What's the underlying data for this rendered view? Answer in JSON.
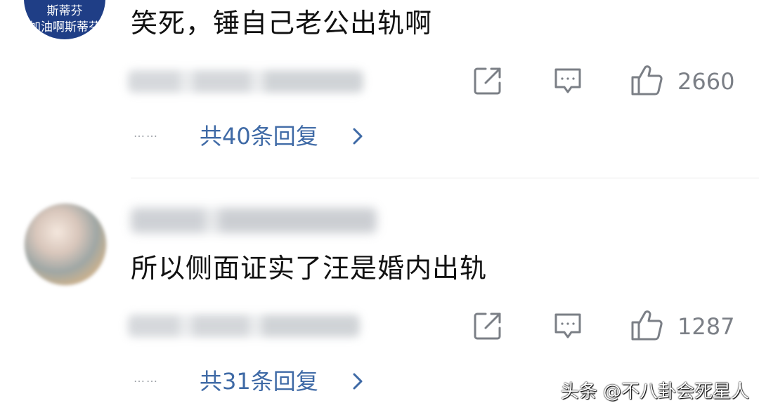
{
  "comments": [
    {
      "avatar_name": "斯蒂芬",
      "avatar_slogan": "加油啊斯蒂芬",
      "text": "笑死，锤自己老公出轨啊",
      "likes": "2660",
      "replies_label": "共40条回复",
      "dots": "……"
    },
    {
      "text": "所以侧面证实了汪是婚内出轨",
      "likes": "1287",
      "replies_label": "共31条回复",
      "dots": "……"
    }
  ],
  "icons": {
    "share": "share-icon",
    "reply": "comment-icon",
    "like": "thumbs-up-icon",
    "expand": "chevron-right-icon"
  },
  "colors": {
    "link": "#3f6aa6",
    "icon": "#7b7f86",
    "text": "#111111"
  },
  "watermark": "头条 @不八卦会死星人"
}
